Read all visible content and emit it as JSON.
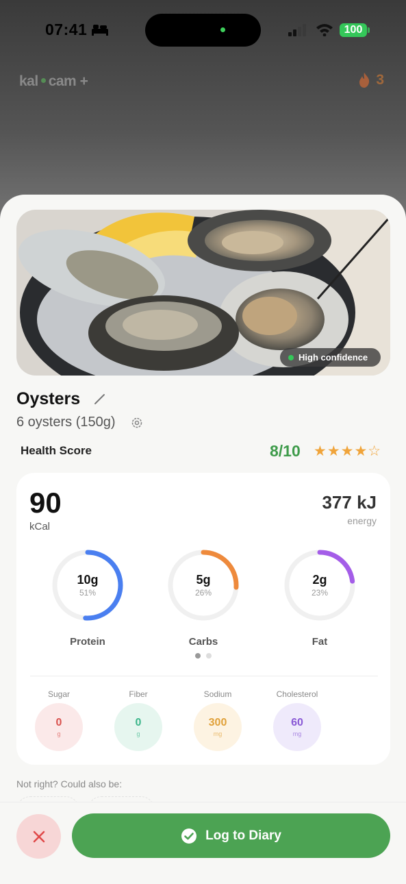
{
  "status_bar": {
    "time": "07:41",
    "battery": "100"
  },
  "app": {
    "brand_left": "kal",
    "brand_right": "cam +",
    "streak_count": "3"
  },
  "photo": {
    "confidence_label": "High confidence"
  },
  "food": {
    "name": "Oysters",
    "portion": "6 oysters (150g)"
  },
  "health": {
    "label": "Health Score",
    "score": "8/10",
    "stars": "★★★★☆",
    "rating": 4,
    "max_rating": 5
  },
  "energy": {
    "kcal": "90",
    "kcal_unit": "kCal",
    "kj": "377 kJ",
    "kj_unit": "energy"
  },
  "macros": [
    {
      "label": "Protein",
      "value": "10g",
      "percent": "51%",
      "fraction": 0.51,
      "color": "#4a7ff0"
    },
    {
      "label": "Carbs",
      "value": "5g",
      "percent": "26%",
      "fraction": 0.26,
      "color": "#ee8a3c"
    },
    {
      "label": "Fat",
      "value": "2g",
      "percent": "23%",
      "fraction": 0.23,
      "color": "#a45de8"
    }
  ],
  "pager": {
    "active": 0,
    "total": 2
  },
  "micros": [
    {
      "label": "Sugar",
      "value": "0",
      "unit": "g",
      "color": "#d9534f",
      "bg": "#fbe9e9"
    },
    {
      "label": "Fiber",
      "value": "0",
      "unit": "g",
      "color": "#3bb58a",
      "bg": "#e6f6ef"
    },
    {
      "label": "Sodium",
      "value": "300",
      "unit": "mg",
      "color": "#e0a13a",
      "bg": "#fdf3e2"
    },
    {
      "label": "Cholesterol",
      "value": "60",
      "unit": "mg",
      "color": "#8a5ad6",
      "bg": "#efeafb"
    }
  ],
  "alternatives": {
    "prompt": "Not right? Could also be:"
  },
  "actions": {
    "log_label": "Log to Diary"
  },
  "colors": {
    "accent_green": "#4ca353",
    "close_bg": "#f7d6d6",
    "close_icon": "#e04848"
  }
}
